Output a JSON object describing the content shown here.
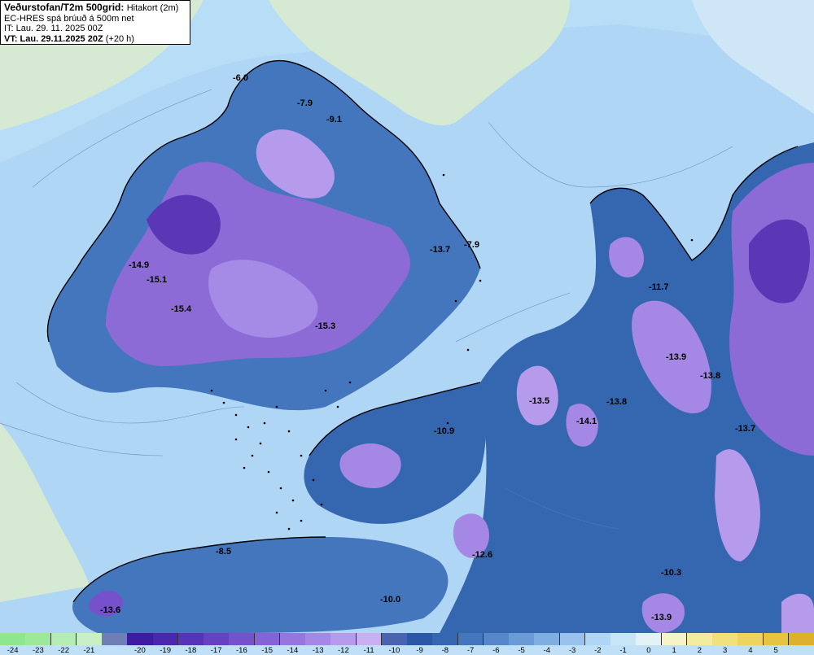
{
  "header": {
    "title": "Veðurstofan/T2m 500grid:",
    "subtitle": "Hitakort (2m)",
    "model_line": "EC-HRES spá brúuð á 500m net",
    "issue_time": "IT: Lau. 29. 11. 2025 00Z",
    "valid_time": "VT: Lau. 29.11.2025 20Z",
    "lead_time": "(+20 h)"
  },
  "colors": {
    "land": "#d6ead3",
    "sea": "#b8ddf7"
  },
  "temperature_labels": [
    "-6.0",
    "-7.9",
    "-9.1",
    "-13.7",
    "-7.9",
    "-14.9",
    "-15.1",
    "-15.4",
    "-15.3",
    "-11.7",
    "-13.9",
    "-13.8",
    "-13.5",
    "-13.8",
    "-14.1",
    "-13.7",
    "-10.9",
    "-12.6",
    "-8.5",
    "-10.3",
    "-13.6",
    "-10.0",
    "-13.9"
  ],
  "legend": {
    "swatches": [
      {
        "label": "-24",
        "color": "#8ee68e"
      },
      {
        "label": "-23",
        "color": "#9ce99c"
      },
      {
        "label": "-22",
        "color": "#b3edb3"
      },
      {
        "label": "-21",
        "color": "#c8f0c4"
      },
      {
        "label": "",
        "color": "#6f7fb5"
      },
      {
        "label": "-20",
        "color": "#3d1ca3"
      },
      {
        "label": "-19",
        "color": "#4a27ad"
      },
      {
        "label": "-18",
        "color": "#5733b8"
      },
      {
        "label": "-17",
        "color": "#6642c2"
      },
      {
        "label": "-16",
        "color": "#7552cc"
      },
      {
        "label": "-15",
        "color": "#8563d6"
      },
      {
        "label": "-14",
        "color": "#9575de"
      },
      {
        "label": "-13",
        "color": "#a588e6"
      },
      {
        "label": "-12",
        "color": "#b69bed"
      },
      {
        "label": "-11",
        "color": "#c8b0f3"
      },
      {
        "label": "-10",
        "color": "#4a63b0"
      },
      {
        "label": "-9",
        "color": "#2a57a6"
      },
      {
        "label": "-8",
        "color": "#3566b0"
      },
      {
        "label": "-7",
        "color": "#4476bd"
      },
      {
        "label": "-6",
        "color": "#5688c9"
      },
      {
        "label": "-5",
        "color": "#6a9bd6"
      },
      {
        "label": "-4",
        "color": "#80aee2"
      },
      {
        "label": "-3",
        "color": "#98c2ed"
      },
      {
        "label": "-2",
        "color": "#b0d6f5"
      },
      {
        "label": "-1",
        "color": "#c6e6f6"
      },
      {
        "label": "0",
        "color": "#e3f3f5"
      },
      {
        "label": "1",
        "color": "#f6f3c8"
      },
      {
        "label": "2",
        "color": "#f3ec9f"
      },
      {
        "label": "3",
        "color": "#f0e17d"
      },
      {
        "label": "4",
        "color": "#ecd45e"
      },
      {
        "label": "5",
        "color": "#e6c442"
      },
      {
        "label": "",
        "color": "#ddb02d"
      }
    ]
  }
}
